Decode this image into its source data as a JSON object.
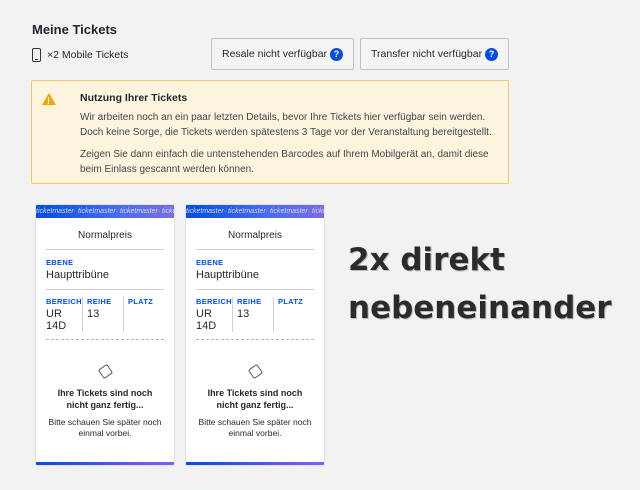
{
  "title": "Meine Tickets",
  "mobile_tickets": "×2 Mobile Tickets",
  "buttons": {
    "resale": "Resale nicht verfügbar",
    "transfer": "Transfer nicht verfügbar",
    "help_glyph": "?"
  },
  "notice": {
    "title": "Nutzung Ihrer Tickets",
    "text1": "Wir arbeiten noch an ein paar letzten Details, bevor Ihre Tickets hier verfügbar sein werden. Doch keine Sorge, die Tickets werden spätestens 3 Tage vor der Veranstaltung bereitgestellt.",
    "text2": "Zeigen Sie dann einfach die untenstehenden Barcodes auf Ihrem Mobilgerät an, damit diese beim Einlass gescannt werden können."
  },
  "tickets": [
    {
      "brand": "ticketmaster· ticketmaster· ticketmaster· ticketmaster·",
      "type": "Normalpreis",
      "ebene_label": "EBENE",
      "ebene": "Haupttribüne",
      "bereich_label": "BEREICH",
      "bereich": "UR 14D",
      "reihe_label": "REIHE",
      "reihe": "13",
      "platz_label": "PLATZ",
      "platz": "",
      "pending": "Ihre Tickets sind noch nicht ganz fertig...",
      "later": "Bitte schauen Sie später noch einmal vorbei."
    },
    {
      "brand": "ticketmaster· ticketmaster· ticketmaster· ticketmaster·",
      "type": "Normalpreis",
      "ebene_label": "EBENE",
      "ebene": "Haupttribüne",
      "bereich_label": "BEREICH",
      "bereich": "UR 14D",
      "reihe_label": "REIHE",
      "reihe": "13",
      "platz_label": "PLATZ",
      "platz": "",
      "pending": "Ihre Tickets sind noch nicht ganz fertig...",
      "later": "Bitte schauen Sie später noch einmal vorbei."
    }
  ],
  "overlay": {
    "line1": "2x direkt",
    "line2": "nebeneinander"
  },
  "colors": {
    "accent": "#024ddf",
    "warning": "#f0a500",
    "notice_bg": "#fdf4de"
  }
}
